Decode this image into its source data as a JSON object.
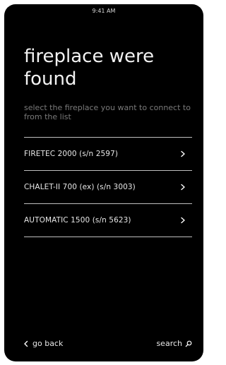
{
  "status_bar": {
    "time": "9:41 AM"
  },
  "header": {
    "title": "fireplace were found",
    "subtitle": "select the fireplace you want to connect to from the list"
  },
  "fireplaces": [
    {
      "label": "FIRETEC 2000 (s/n 2597)",
      "icon": "chevron-right-icon"
    },
    {
      "label": "CHALET-II 700 (ex) (s/n 3003)",
      "icon": "chevron-right-icon"
    },
    {
      "label": "AUTOMATIC 1500 (s/n 5623)",
      "icon": "chevron-right-icon"
    }
  ],
  "footer": {
    "back_label": "go back",
    "back_icon": "chevron-left-icon",
    "search_label": "search",
    "search_icon": "search-icon"
  },
  "colors": {
    "background": "#000000",
    "text": "#f2f2f2",
    "muted_text": "#7a7a7a",
    "divider": "#bfbfbf"
  }
}
